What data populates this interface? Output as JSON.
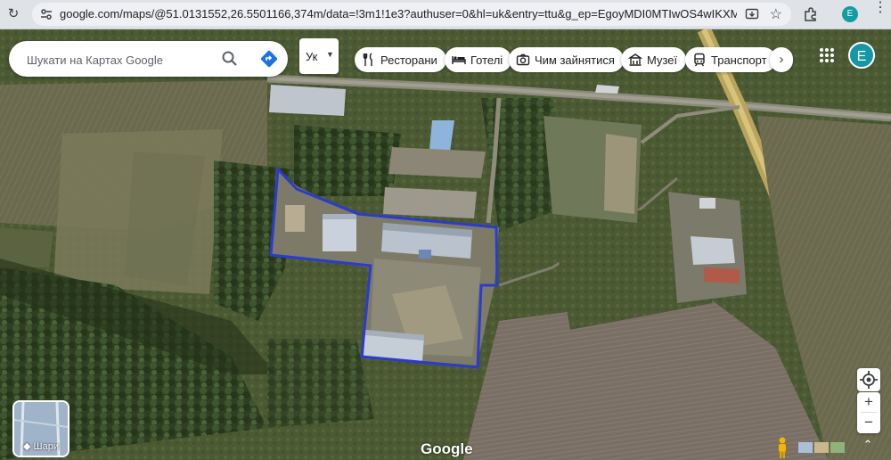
{
  "browser": {
    "url": "google.com/maps/@51.0131552,26.5501166,374m/data=!3m1!1e3?authuser=0&hl=uk&entry=ttu&g_ep=EgoyMDI0MTIwOS4wIKXMDSoASAFQ...",
    "profile_initial": "E"
  },
  "search": {
    "placeholder": "Шукати на Картах Google"
  },
  "language": {
    "label": "Ук"
  },
  "chips": [
    {
      "label": "Ресторани",
      "icon": "fork-knife-icon"
    },
    {
      "label": "Готелі",
      "icon": "bed-icon"
    },
    {
      "label": "Чим зайнятися",
      "icon": "camera-icon"
    },
    {
      "label": "Музеї",
      "icon": "museum-icon"
    },
    {
      "label": "Транспорт",
      "icon": "train-icon"
    }
  ],
  "account": {
    "initial": "E",
    "color": "#1598a5"
  },
  "layers": {
    "label": "Шари"
  },
  "map": {
    "type": "satellite",
    "coordinates": "51.0131552,26.5501166",
    "zoom_label": "374m",
    "outline_color": "#2b3bd0"
  },
  "controls": {
    "zoom_in": "+",
    "zoom_out": "−"
  },
  "logo": "Google"
}
